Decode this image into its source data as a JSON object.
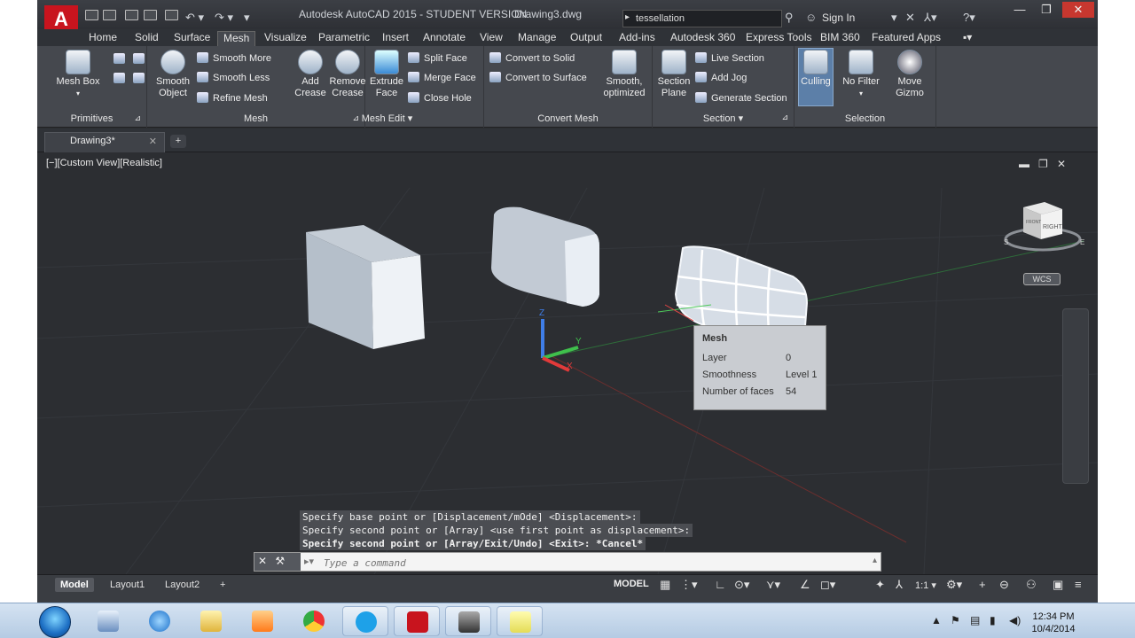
{
  "titlebar": {
    "app_title": "Autodesk AutoCAD 2015 - STUDENT VERSION",
    "document": "Drawing3.dwg",
    "search_value": "tessellation",
    "sign_in": "Sign In"
  },
  "tabs": [
    "Home",
    "Solid",
    "Surface",
    "Mesh",
    "Visualize",
    "Parametric",
    "Insert",
    "Annotate",
    "View",
    "Manage",
    "Output",
    "Add-ins",
    "Autodesk 360",
    "Express Tools",
    "BIM 360",
    "Featured Apps"
  ],
  "active_tab": "Mesh",
  "ribbon": {
    "primitives": {
      "label": "Primitives",
      "mesh_box": "Mesh Box"
    },
    "mesh": {
      "label": "Mesh",
      "smooth_object": "Smooth\nObject",
      "smooth_more": "Smooth More",
      "smooth_less": "Smooth Less",
      "refine_mesh": "Refine Mesh"
    },
    "mesh_edit": {
      "label": "Mesh Edit",
      "add_crease": "Add\nCrease",
      "remove_crease": "Remove\nCrease",
      "extrude_face": "Extrude\nFace",
      "split_face": "Split Face",
      "merge_face": "Merge Face",
      "close_hole": "Close Hole"
    },
    "convert_mesh": {
      "label": "Convert Mesh",
      "to_solid": "Convert to Solid",
      "to_surface": "Convert to Surface",
      "smooth_optimized": "Smooth,\noptimized"
    },
    "section": {
      "label": "Section",
      "section_plane": "Section\nPlane",
      "live_section": "Live Section",
      "add_jog": "Add Jog",
      "generate_section": "Generate Section"
    },
    "selection": {
      "label": "Selection",
      "culling": "Culling",
      "no_filter": "No Filter",
      "move_gizmo": "Move\nGizmo"
    }
  },
  "file_tab": {
    "name": "Drawing3*"
  },
  "viewport": {
    "label": "[−][Custom View][Realistic]",
    "ucs": {
      "x": "X",
      "y": "Y",
      "z": "Z"
    },
    "viewcube": {
      "right": "RIGHT",
      "front": "FRONT",
      "south": "S",
      "east": "E"
    },
    "wcs": "WCS"
  },
  "tooltip": {
    "title": "Mesh",
    "rows": [
      {
        "key": "Layer",
        "value": "0"
      },
      {
        "key": "Smoothness",
        "value": "Level 1"
      },
      {
        "key": "Number of faces",
        "value": "54"
      }
    ]
  },
  "command": {
    "history": [
      "Specify base point or [Displacement/mOde] <Displacement>:",
      "Specify second point or [Array] <use first point as displacement>:",
      "Specify second point or [Array/Exit/Undo] <Exit>: *Cancel*"
    ],
    "placeholder": "Type a command"
  },
  "status": {
    "layout_tabs": [
      "Model",
      "Layout1",
      "Layout2"
    ],
    "space": "MODEL",
    "scale": "1:1 ▾"
  },
  "taskbar": {
    "time": "12:34 PM",
    "date": "10/4/2014"
  }
}
